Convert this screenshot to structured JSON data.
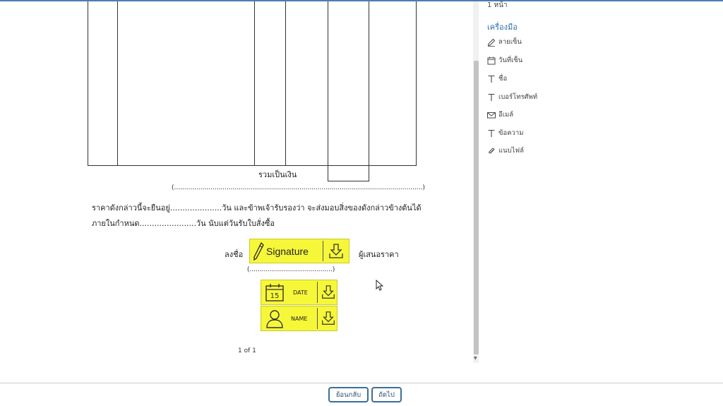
{
  "document": {
    "total_label": "รวมเป็นเงิน",
    "amount_words_line": "(...........................................................................................................................)",
    "text_line_1": "ราคาดังกล่าวนี้จะยืนอยู่.....................วัน และข้าพเจ้ารับรองว่า จะส่งมอบสิ่งของดังกล่าวข้างต้นได้",
    "text_line_2": "ภายในกำหนด.......................วัน นับแต่วันรับใบสั่งซื้อ",
    "sign_label": "ลงชื่อ",
    "signer_role": "ผู้เสนอราคา",
    "signer_name_line": "(.........................................)",
    "page_indicator": "1 of 1"
  },
  "fields": {
    "signature": {
      "label": "Signature",
      "icon": "pen-icon",
      "action_icon": "download-icon"
    },
    "date": {
      "label": "DATE",
      "icon": "calendar-icon",
      "action_icon": "download-icon",
      "calendar_day": "15"
    },
    "name": {
      "label": "NAME",
      "icon": "person-icon",
      "action_icon": "download-icon"
    }
  },
  "panel": {
    "page_count": "1 หน้า",
    "tools_title": "เครื่องมือ",
    "tools": [
      {
        "label": "ลายเซ็น",
        "icon": "pencil-icon"
      },
      {
        "label": "วันที่เซ็น",
        "icon": "calendar-icon"
      },
      {
        "label": "ชื่อ",
        "icon": "text-icon"
      },
      {
        "label": "เบอร์โทรศัพท์",
        "icon": "text-icon"
      },
      {
        "label": "อีเมล์",
        "icon": "mail-icon"
      },
      {
        "label": "ข้อความ",
        "icon": "text-icon"
      },
      {
        "label": "แนบไฟล์",
        "icon": "paperclip-icon"
      }
    ]
  },
  "footer": {
    "back_label": "ย้อนกลับ",
    "next_label": "ถัดไป"
  },
  "colors": {
    "field_highlight": "#f7f73a",
    "accent": "#2f6fa7",
    "button_border": "#3c6e99"
  }
}
